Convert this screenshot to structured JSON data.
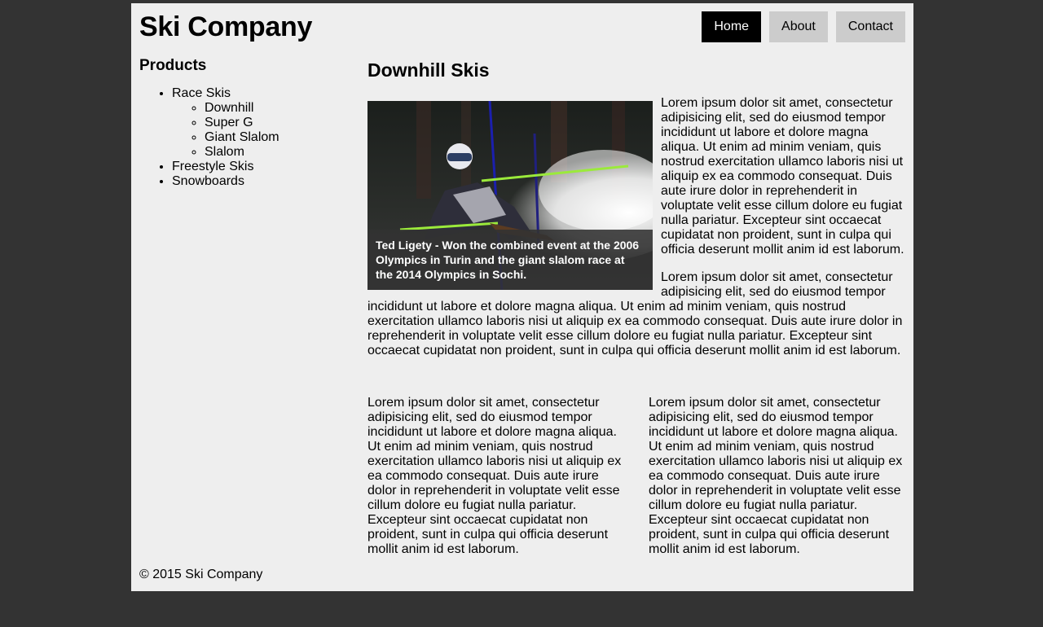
{
  "site": {
    "title": "Ski Company"
  },
  "nav": {
    "items": [
      {
        "label": "Home",
        "active": true
      },
      {
        "label": "About",
        "active": false
      },
      {
        "label": "Contact",
        "active": false
      }
    ]
  },
  "sidebar": {
    "heading": "Products",
    "items": [
      {
        "label": "Race Skis",
        "children": [
          "Downhill",
          "Super G",
          "Giant Slalom",
          "Slalom"
        ]
      },
      {
        "label": "Freestyle Skis"
      },
      {
        "label": "Snowboards"
      }
    ]
  },
  "main": {
    "heading": "Downhill Skis",
    "image_caption": "Ted Ligety - Won the combined event at the 2006 Olympics in Turin and the giant slalom race at the 2014 Olympics in Sochi.",
    "paragraphs": [
      "Lorem ipsum dolor sit amet, consectetur adipisicing elit, sed do eiusmod tempor incididunt ut labore et dolore magna aliqua. Ut enim ad minim veniam, quis nostrud exercitation ullamco laboris nisi ut aliquip ex ea commodo consequat. Duis aute irure dolor in reprehenderit in voluptate velit esse cillum dolore eu fugiat nulla pariatur. Excepteur sint occaecat cupidatat non proident, sunt in culpa qui officia deserunt mollit anim id est laborum.",
      "Lorem ipsum dolor sit amet, consectetur adipisicing elit, sed do eiusmod tempor incididunt ut labore et dolore magna aliqua. Ut enim ad minim veniam, quis nostrud exercitation ullamco laboris nisi ut aliquip ex ea commodo consequat. Duis aute irure dolor in reprehenderit in voluptate velit esse cillum dolore eu fugiat nulla pariatur. Excepteur sint occaecat cupidatat non proident, sunt in culpa qui officia deserunt mollit anim id est laborum."
    ],
    "columns": [
      "Lorem ipsum dolor sit amet, consectetur adipisicing elit, sed do eiusmod tempor incididunt ut labore et dolore magna aliqua. Ut enim ad minim veniam, quis nostrud exercitation ullamco laboris nisi ut aliquip ex ea commodo consequat. Duis aute irure dolor in reprehenderit in voluptate velit esse cillum dolore eu fugiat nulla pariatur. Excepteur sint occaecat cupidatat non proident, sunt in culpa qui officia deserunt mollit anim id est laborum.",
      "Lorem ipsum dolor sit amet, consectetur adipisicing elit, sed do eiusmod tempor incididunt ut labore et dolore magna aliqua. Ut enim ad minim veniam, quis nostrud exercitation ullamco laboris nisi ut aliquip ex ea commodo consequat. Duis aute irure dolor in reprehenderit in voluptate velit esse cillum dolore eu fugiat nulla pariatur. Excepteur sint occaecat cupidatat non proident, sunt in culpa qui officia deserunt mollit anim id est laborum."
    ]
  },
  "footer": {
    "text": "© 2015 Ski Company"
  },
  "colors": {
    "background": "#333333",
    "page": "#eeeeee",
    "nav_active": "#000000",
    "nav_inactive": "#cccccc"
  }
}
